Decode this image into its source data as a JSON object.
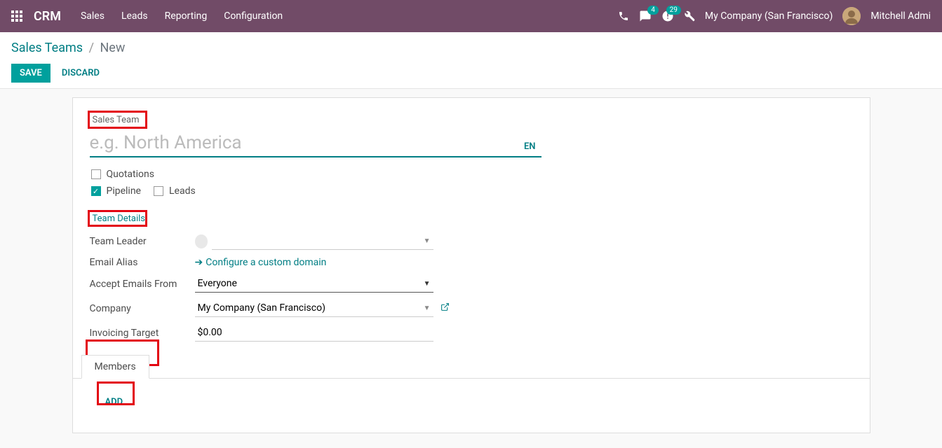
{
  "navbar": {
    "brand": "CRM",
    "menu": [
      "Sales",
      "Leads",
      "Reporting",
      "Configuration"
    ],
    "msg_count": "4",
    "activity_count": "29",
    "company": "My Company (San Francisco)",
    "user": "Mitchell Admi"
  },
  "breadcrumb": {
    "parent": "Sales Teams",
    "current": "New"
  },
  "actions": {
    "save": "SAVE",
    "discard": "DISCARD"
  },
  "form": {
    "name_label": "Sales Team",
    "name_placeholder": "e.g. North America",
    "name_value": "",
    "lang": "EN",
    "checkboxes": {
      "quotations": {
        "label": "Quotations",
        "checked": false
      },
      "pipeline": {
        "label": "Pipeline",
        "checked": true
      },
      "leads": {
        "label": "Leads",
        "checked": false
      }
    },
    "section_details": "Team Details",
    "team_leader_label": "Team Leader",
    "team_leader_value": "",
    "email_alias_label": "Email Alias",
    "config_domain": "Configure a custom domain",
    "accept_label": "Accept Emails From",
    "accept_value": "Everyone",
    "company_label": "Company",
    "company_value": "My Company (San Francisco)",
    "invoicing_label": "Invoicing Target",
    "invoicing_value": "$0.00",
    "tab_members": "Members",
    "add": "ADD"
  }
}
